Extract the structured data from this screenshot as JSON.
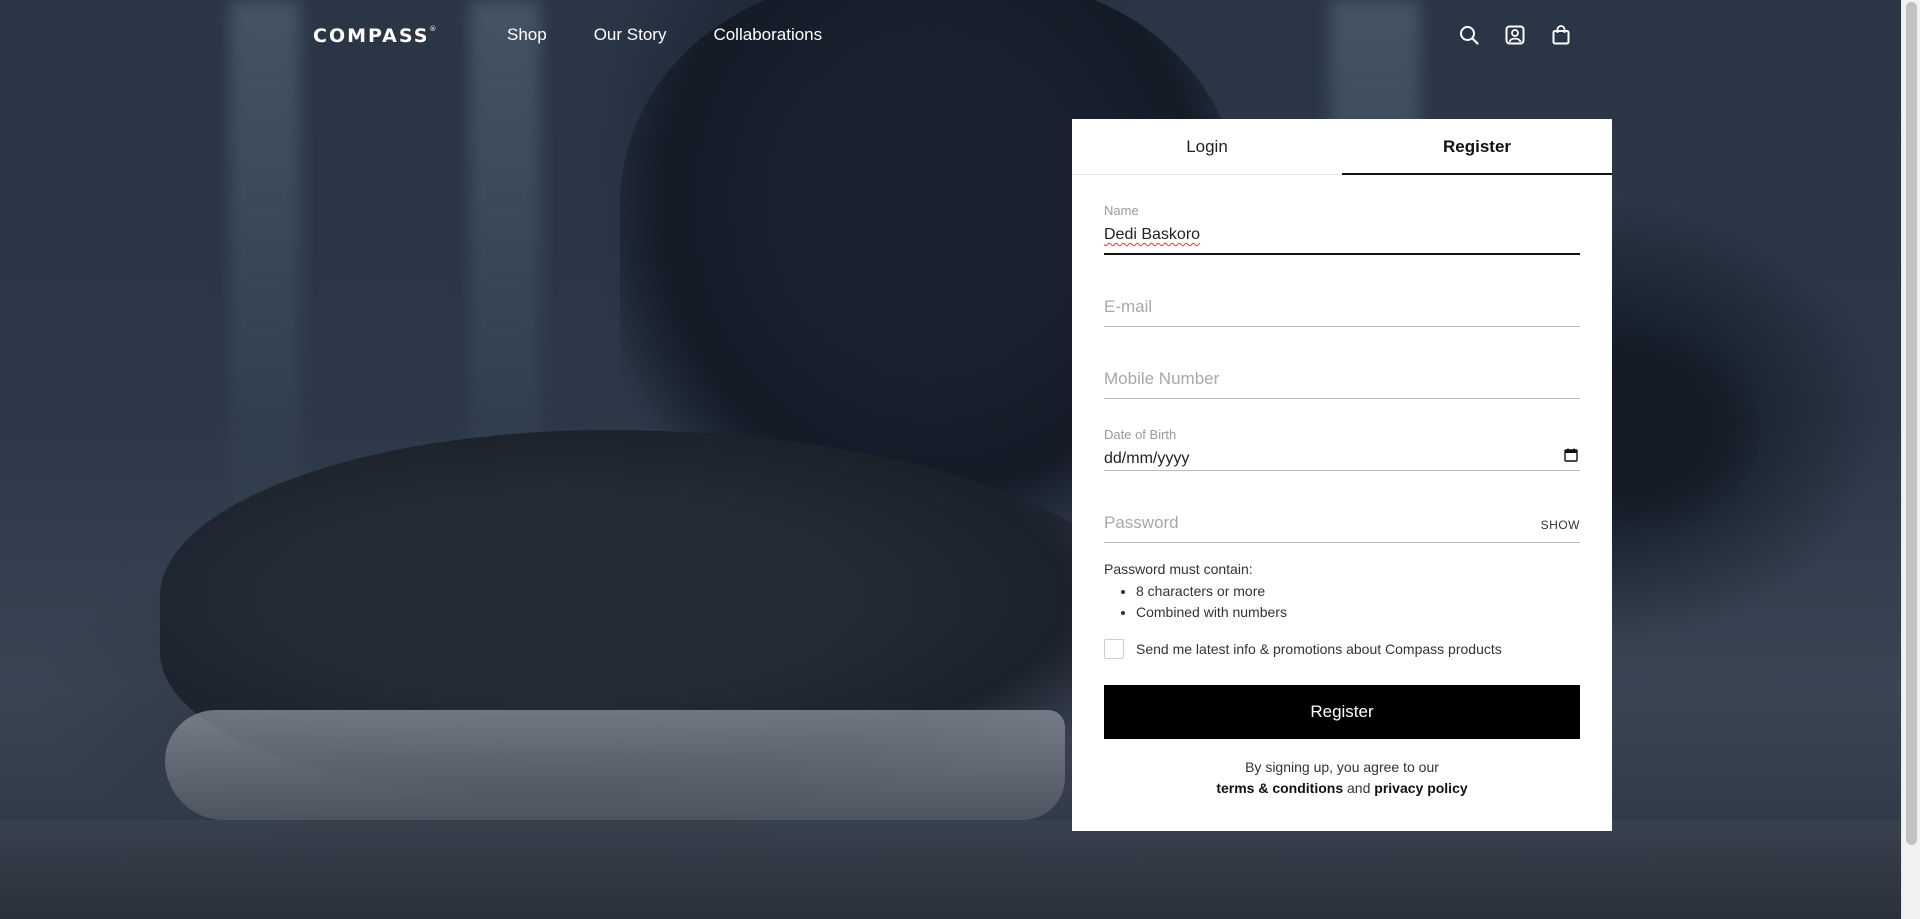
{
  "header": {
    "logo": "COMPASS",
    "logo_mark": "®",
    "nav": [
      {
        "label": "Shop"
      },
      {
        "label": "Our Story"
      },
      {
        "label": "Collaborations"
      }
    ],
    "icons": [
      "search-icon",
      "account-icon",
      "bag-icon"
    ]
  },
  "auth": {
    "tabs": [
      {
        "label": "Login",
        "active": false
      },
      {
        "label": "Register",
        "active": true
      }
    ],
    "fields": {
      "name": {
        "label": "Name",
        "value": "Dedi Baskoro"
      },
      "email": {
        "placeholder": "E-mail"
      },
      "mobile": {
        "placeholder": "Mobile Number"
      },
      "dob": {
        "label": "Date of Birth",
        "value": "dd/mm/yyyy"
      },
      "password": {
        "placeholder": "Password",
        "toggle": "SHOW"
      }
    },
    "password_rules": {
      "title": "Password must contain:",
      "items": [
        "8 characters or more",
        "Combined with numbers"
      ]
    },
    "promo_label": "Send me latest info & promotions about Compass products",
    "promo_checked": false,
    "submit_label": "Register",
    "agreement": {
      "prefix": "By signing up, you agree to our",
      "terms": "terms & conditions",
      "and": "and",
      "privacy": "privacy policy"
    }
  },
  "colors": {
    "accent": "#000000",
    "panel_bg": "#ffffff"
  }
}
